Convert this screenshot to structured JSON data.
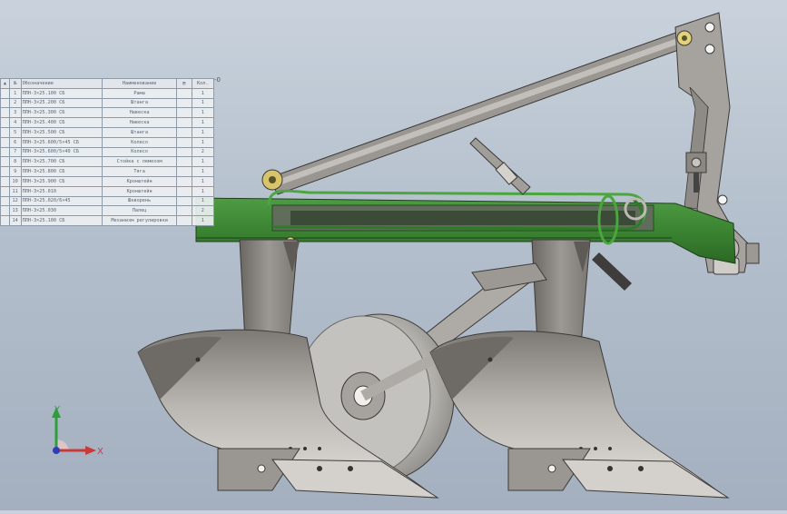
{
  "bom": {
    "corner_mark": "-0",
    "header": [
      "▲",
      "№",
      "Обозначение",
      "Наименование",
      "▤",
      "Кол."
    ],
    "rows": [
      [
        "",
        "1",
        "ПЛН-3×25.100 СБ",
        "Рама",
        "",
        "1"
      ],
      [
        "",
        "2",
        "ПЛН-3×25.200 СБ",
        "Штанга",
        "",
        "1"
      ],
      [
        "",
        "3",
        "ПЛН-3×25.300 СБ",
        "Навеска",
        "",
        "1"
      ],
      [
        "",
        "4",
        "ПЛН-3×25.400 СБ",
        "Навеска",
        "",
        "1"
      ],
      [
        "",
        "5",
        "ПЛН-3×25.500 СБ",
        "Штанга",
        "",
        "1"
      ],
      [
        "",
        "6",
        "ПЛН-3×25.600/5×45 СБ",
        "Колесо",
        "",
        "1"
      ],
      [
        "",
        "7",
        "ПЛН-3×25.600/5×40 СБ",
        "Колесо",
        "",
        "2"
      ],
      [
        "",
        "8",
        "ПЛН-3×25.700 СБ",
        "Стойка с лемехом",
        "",
        "1"
      ],
      [
        "",
        "9",
        "ПЛН-3×25.800 СБ",
        "Тяга",
        "",
        "1"
      ],
      [
        "",
        "10",
        "ПЛН-3×25.900 СБ",
        "Кронштейн",
        "",
        "1"
      ],
      [
        "",
        "11",
        "ПЛН-3×25.010",
        "Кронштейн",
        "",
        "1"
      ],
      [
        "",
        "12",
        "ПЛН-3×25.020/6×45",
        "Шкворень",
        "",
        "1"
      ],
      [
        "",
        "13",
        "ПЛН-3×25.030",
        "Палец",
        "",
        "2"
      ],
      [
        "",
        "14",
        "ПЛН-3×25.100 СБ",
        "Механизм регулировки",
        "",
        "1"
      ]
    ]
  },
  "triad": {
    "y_label": "Y",
    "x_label": "X"
  },
  "colors": {
    "frame_green": "#3f8a36",
    "frame_green_dark": "#2c6a26",
    "steel": "#8f8c88",
    "steel_dark": "#6e6b68",
    "steel_light": "#c4c1bc",
    "tire": "#b8b6b2"
  }
}
